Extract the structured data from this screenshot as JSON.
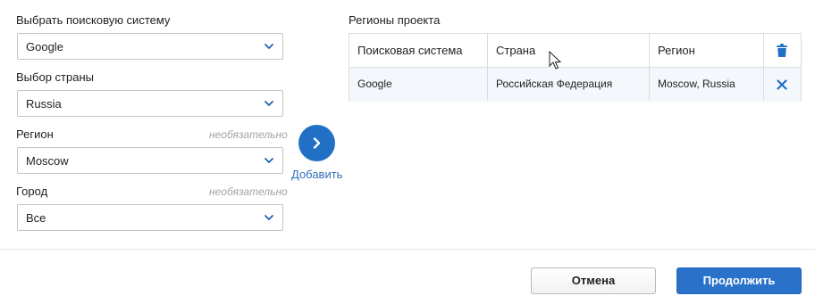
{
  "form": {
    "search_engine": {
      "label": "Выбрать поисковую систему",
      "value": "Google"
    },
    "country": {
      "label": "Выбор страны",
      "value": "Russia"
    },
    "region": {
      "label": "Регион",
      "optional": "необязательно",
      "value": "Moscow"
    },
    "city": {
      "label": "Город",
      "optional": "необязательно",
      "value": "Все"
    }
  },
  "add": {
    "label": "Добавить"
  },
  "regions_table": {
    "title": "Регионы проекта",
    "columns": [
      "Поисковая система",
      "Страна",
      "Регион"
    ],
    "rows": [
      {
        "search_engine": "Google",
        "country": "Российская Федерация",
        "region": "Moscow, Russia"
      }
    ]
  },
  "footer": {
    "cancel_label": "Отмена",
    "continue_label": "Продолжить"
  },
  "colors": {
    "accent": "#2170c5",
    "delete_icon": "#1f6fc6",
    "row_highlight": "#f4f7fb"
  },
  "icons": [
    "chevron-down-icon",
    "chevron-right-icon",
    "trash-icon",
    "close-icon",
    "mouse-cursor-icon"
  ]
}
